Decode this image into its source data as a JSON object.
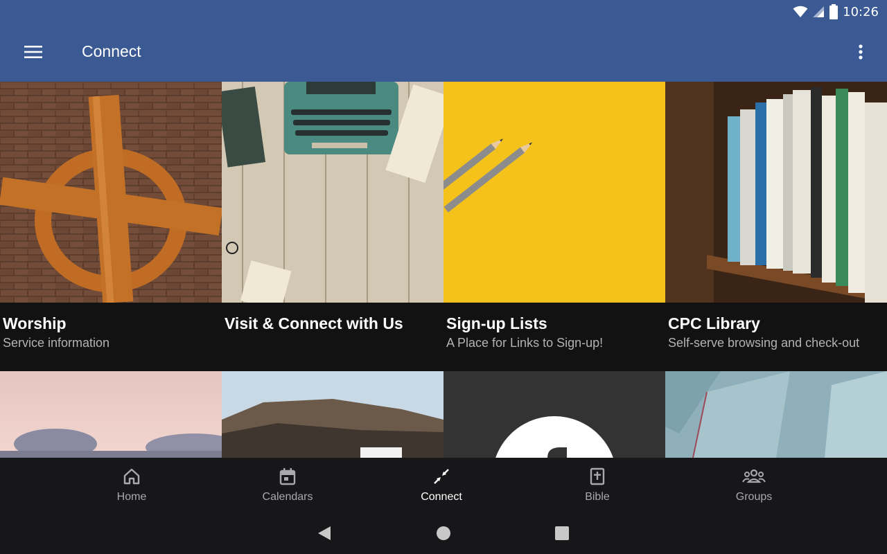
{
  "status_bar": {
    "time": "10:26",
    "icons": [
      "wifi-icon",
      "signal-icon",
      "battery-icon"
    ]
  },
  "app_bar": {
    "title": "Connect",
    "menu_icon": "hamburger-menu-icon",
    "overflow_icon": "more-vert-icon",
    "color": "#3b5a94"
  },
  "tiles": [
    {
      "title": "Worship",
      "subtitle": "Service information",
      "image": "wooden-cross-on-brick-wall"
    },
    {
      "title": "Visit & Connect with Us",
      "subtitle": "",
      "image": "typewriter-on-wood-desk"
    },
    {
      "title": "Sign-up Lists",
      "subtitle": "A Place for Links to Sign-up!",
      "image": "pencils-on-yellow"
    },
    {
      "title": "CPC Library",
      "subtitle": "Self-serve browsing and check-out",
      "image": "library-bookshelf"
    },
    {
      "title": "",
      "subtitle": "",
      "image": "pink-sky-clouds"
    },
    {
      "title": "",
      "subtitle": "",
      "image": "cliff-landscape"
    },
    {
      "title": "",
      "subtitle": "",
      "image": "white-circle-logo-on-dark"
    },
    {
      "title": "",
      "subtitle": "",
      "image": "succulent-plant"
    }
  ],
  "bottom_nav": {
    "items": [
      {
        "label": "Home",
        "icon": "home-icon",
        "active": false
      },
      {
        "label": "Calendars",
        "icon": "calendar-icon",
        "active": false
      },
      {
        "label": "Connect",
        "icon": "arrows-inward-icon",
        "active": true
      },
      {
        "label": "Bible",
        "icon": "bible-icon",
        "active": false
      },
      {
        "label": "Groups",
        "icon": "groups-icon",
        "active": false
      }
    ]
  },
  "system_nav": {
    "icons": [
      "back-icon",
      "home-circle-icon",
      "recents-square-icon"
    ]
  }
}
